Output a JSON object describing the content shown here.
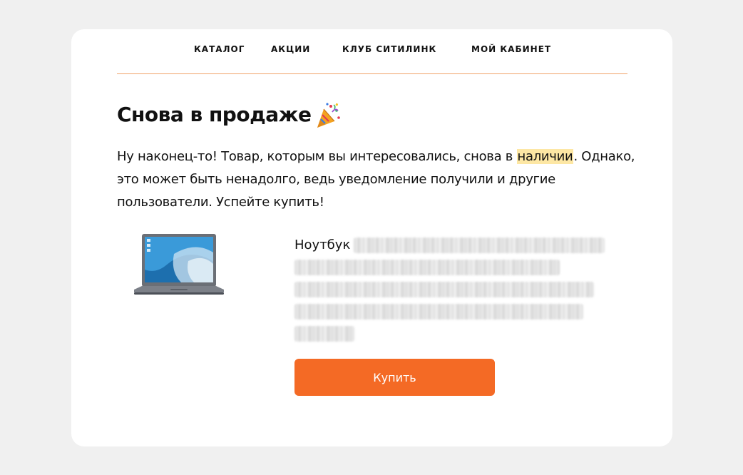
{
  "nav": {
    "items": [
      {
        "label": "КАТАЛОГ"
      },
      {
        "label": "АКЦИИ"
      },
      {
        "label": "КЛУБ СИТИЛИНК"
      },
      {
        "label": "МОЙ КАБИНЕТ"
      }
    ]
  },
  "heading": {
    "title": "Снова в продаже",
    "icon": "party-popper-icon"
  },
  "intro": {
    "text_before": "Ну наконец-то! Товар, которым вы интересовались, снова в ",
    "highlight": "наличии",
    "text_after": ". Однако, это может быть ненадолго, ведь уведомление получили и другие пользователи. Успейте купить!"
  },
  "product": {
    "name_prefix": "Ноутбук",
    "image_icon": "laptop-icon"
  },
  "buy_button": {
    "label": "Купить"
  },
  "colors": {
    "accent": "#f46a25",
    "divider": "#f0a36a",
    "highlight": "#fde7a4",
    "background": "#f0f0f0"
  }
}
